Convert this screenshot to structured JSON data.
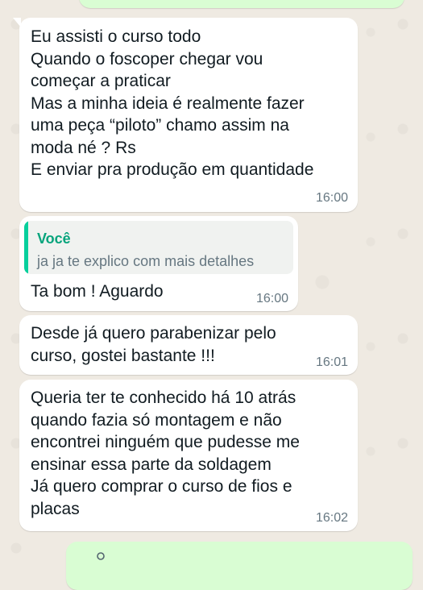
{
  "chat": {
    "messages": [
      {
        "direction": "incoming",
        "text": "Eu assisti o curso todo\nQuando o foscoper chegar vou\ncomeçar a praticar\nMas a minha ideia é realmente fazer\numa peça “piloto” chamo assim na\nmoda né ? Rs\nE enviar pra produção em quantidade",
        "time": "16:00"
      },
      {
        "direction": "incoming",
        "quote": {
          "author": "Você",
          "text": "ja ja te explico com mais detalhes"
        },
        "text": "Ta bom ! Aguardo",
        "time": "16:00"
      },
      {
        "direction": "incoming",
        "text": "Desde já quero parabenizar pelo\ncurso, gostei bastante !!!",
        "time": "16:01"
      },
      {
        "direction": "incoming",
        "text": "Queria ter te conhecido há 10 atrás\nquando fazia só montagem e não\nencontrei ninguém que pudesse me\nensinar essa parte da soldagem\nJá quero comprar o curso de fios e\nplacas",
        "time": "16:02"
      }
    ]
  },
  "colors": {
    "wallpaper": "#efeae2",
    "incoming_bubble": "#ffffff",
    "outgoing_bubble": "#d9fdd3",
    "quote_accent": "#06cf9c",
    "quote_author": "#06a47c",
    "timestamp": "#667781"
  },
  "icons": {
    "outgoing_preview": "person-icon"
  }
}
